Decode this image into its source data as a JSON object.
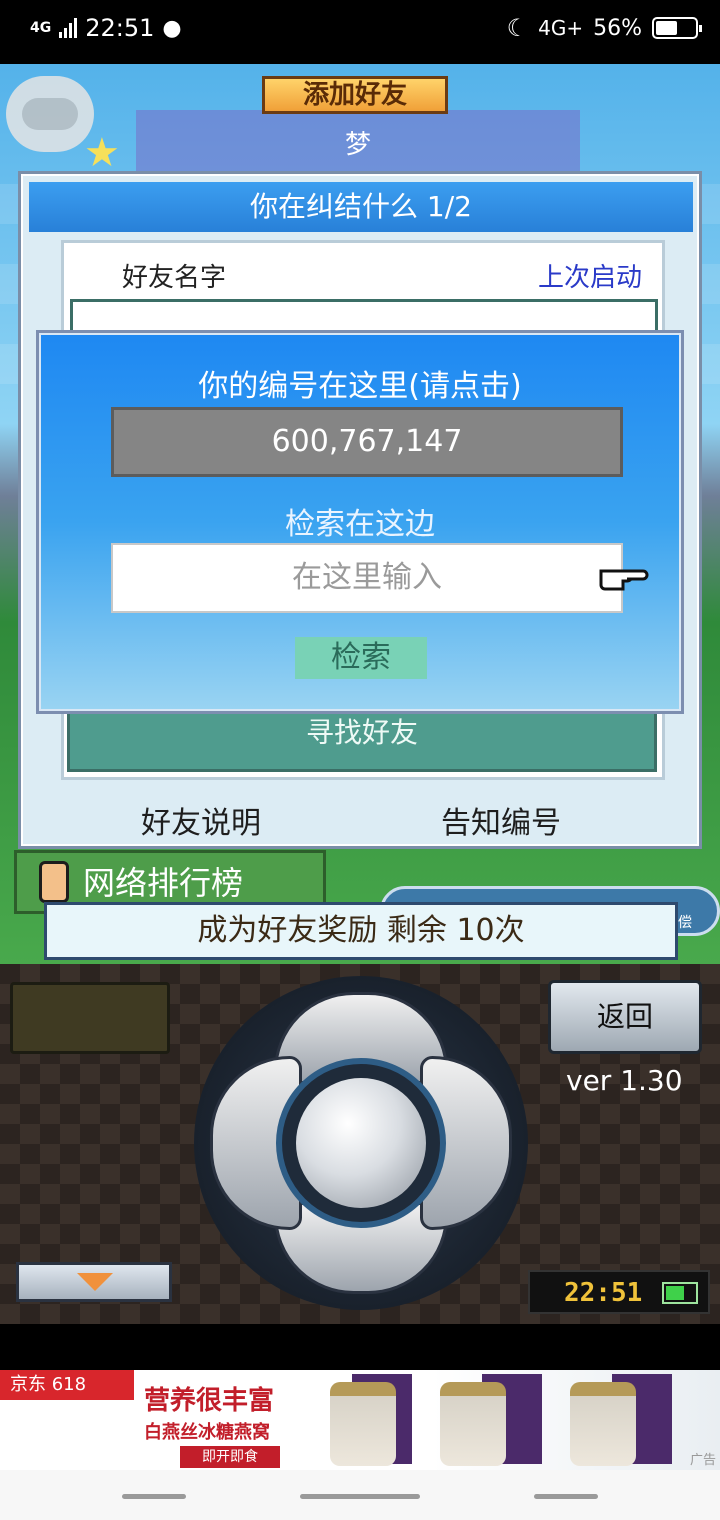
{
  "status_bar": {
    "network": "4G",
    "time": "22:51",
    "mobile_data": "4G+",
    "battery": "56%",
    "battery_level": 0.56,
    "icons": [
      "qq-penguin-icon",
      "moon-icon",
      "battery-icon"
    ]
  },
  "game": {
    "add_friend_tab": "添加好友",
    "bg_title": "梦",
    "dialog": {
      "title": "你在纠结什么 1/2",
      "columns": {
        "name": "好友名字",
        "last_launch": "上次启动"
      },
      "find_friend": "寻找好友",
      "friend_help": "好友说明",
      "tell_id": "告知编号"
    },
    "popup": {
      "id_heading": "你的编号在这里(请点击)",
      "id_value": "600,767,147",
      "search_heading": "检索在这边",
      "search_placeholder": "在这里输入",
      "search_button": "检索"
    },
    "rankings": "网络排行榜",
    "reward_banner": "成为好友奖励 剩余 10次",
    "right_pill_end": "偿"
  },
  "console": {
    "back_button": "返回",
    "version": "ver 1.30",
    "clock": "22:51",
    "battery_level": 0.6,
    "colors": {
      "clock_text": "#f0c23a",
      "battery_fill": "#3fd14a",
      "down_arrow": "#f0913c"
    }
  },
  "ad": {
    "store": "京东 618",
    "headline": "营养很丰富",
    "product": "白燕丝冰糖燕窝",
    "cta": "即开即食",
    "label": "广告"
  }
}
